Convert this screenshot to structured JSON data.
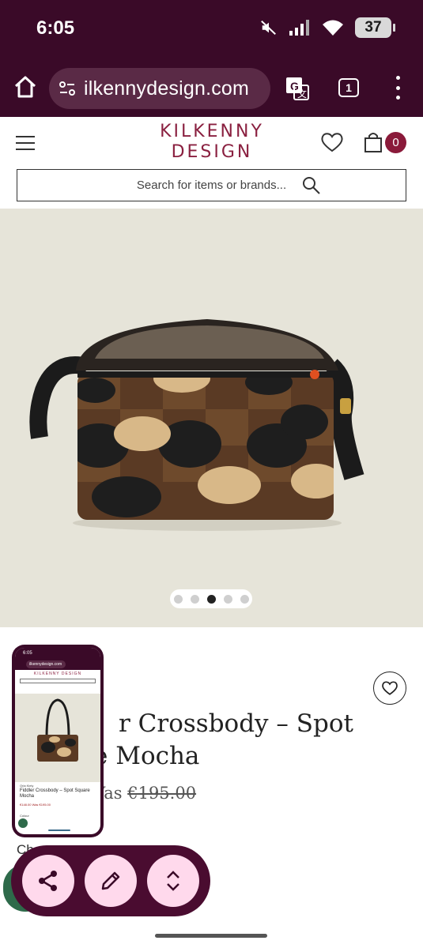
{
  "status_bar": {
    "time": "6:05",
    "battery": "37"
  },
  "browser": {
    "url": "ilkennydesign.com",
    "tab_count": "1"
  },
  "site": {
    "logo_line1": "KILKENNY",
    "logo_line2": "DESIGN",
    "cart_count": "0",
    "search_placeholder": "Search for items or brands..."
  },
  "gallery": {
    "image_count": 5,
    "active_index": 2
  },
  "product": {
    "title_line1": "r Crossbody – Spot",
    "title_line2": "e Mocha",
    "price_prefix": "Vas ",
    "was_price": "€195.00",
    "colour_label": "Ch"
  },
  "mini_preview": {
    "time": "6:05",
    "url": "ilkennydesign.com",
    "logo": "KILKENNY DESIGN",
    "brand": "Orla Kiely",
    "title": "Fiddler Crossbody – Spot Square Mocha",
    "price": "€148.00  Was €195.00",
    "colour": "Colour"
  },
  "colors": {
    "browser_bg": "#3a0a28",
    "brand": "#8a2040",
    "badge": "#8a1a3a",
    "action_bar": "#4a0c30",
    "action_button": "#ffd9ec",
    "fab_green": "#2e6a4a"
  },
  "icons": {
    "status": [
      "mute-icon",
      "signal-icon",
      "wifi-icon"
    ],
    "actions": [
      "share-icon",
      "edit-icon",
      "expand-icon"
    ]
  }
}
